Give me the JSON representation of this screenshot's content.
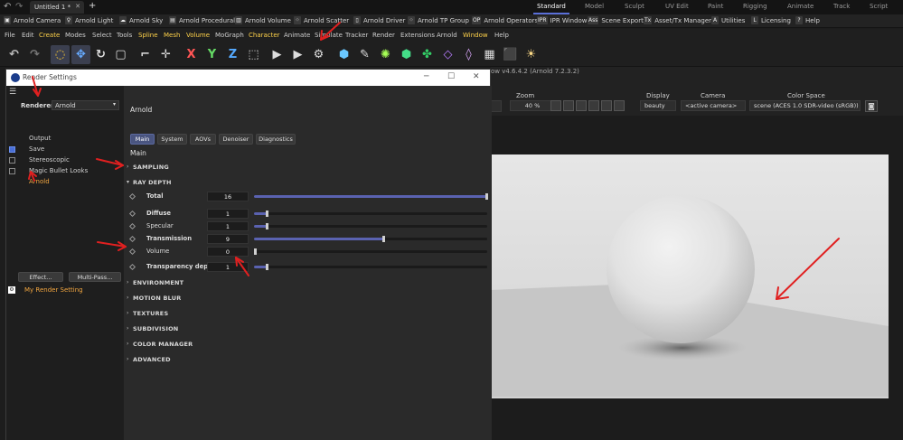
{
  "titlebar": {
    "doc_tab": "Untitled 1 *",
    "plus": "+",
    "layouts": [
      "Standard",
      "Model",
      "Sculpt",
      "UV Edit",
      "Paint",
      "Rigging",
      "Animate",
      "Track",
      "Script"
    ],
    "active_layout": "Standard"
  },
  "pluginbar": [
    {
      "icon": "camera-icon",
      "label": "Arnold Camera",
      "glyph": "▣"
    },
    {
      "icon": "light-icon",
      "label": "Arnold Light",
      "glyph": "♀"
    },
    {
      "icon": "cloud-icon",
      "label": "Arnold Sky",
      "glyph": "☁"
    },
    {
      "icon": "procedural-icon",
      "label": "Arnold Procedural",
      "glyph": "▤"
    },
    {
      "icon": "volume-icon",
      "label": "Arnold Volume",
      "glyph": "▥"
    },
    {
      "icon": "scatter-icon",
      "label": "Arnold Scatter",
      "glyph": "⁘"
    },
    {
      "icon": "driver-icon",
      "label": "Arnold Driver",
      "glyph": "▯"
    },
    {
      "icon": "tp-group-icon",
      "label": "Arnold TP Group",
      "glyph": "⁘"
    },
    {
      "icon": "operators-icon",
      "label": "Arnold Operators",
      "glyph": "OP"
    },
    {
      "icon": "ipr-icon",
      "label": "IPR Window",
      "glyph": "IPR"
    },
    {
      "icon": "ass-icon",
      "label": "Scene Export",
      "glyph": "Ass"
    },
    {
      "icon": "tx-icon",
      "label": "Asset/Tx Manager",
      "glyph": "Tx"
    },
    {
      "icon": "utilities-icon",
      "label": "Utilities",
      "glyph": "A"
    },
    {
      "icon": "licensing-icon",
      "label": "Licensing",
      "glyph": "L"
    },
    {
      "icon": "help-icon",
      "label": "Help",
      "glyph": "?"
    }
  ],
  "menubar": [
    "File",
    "Edit",
    "Create",
    "Modes",
    "Select",
    "Tools",
    "Spline",
    "Mesh",
    "Volume",
    "MoGraph",
    "Character",
    "Animate",
    "Simulate",
    "Tracker",
    "Render",
    "Extensions",
    "Arnold",
    "Window",
    "Help"
  ],
  "toolbar_icons": [
    "undo-icon",
    "redo-icon",
    "live-select-icon",
    "move-icon",
    "rotate-icon",
    "scale-icon",
    "snap-icon",
    "axis-icon",
    "x-axis-icon",
    "y-axis-icon",
    "z-axis-icon",
    "coordinate-icon",
    "render-region-icon",
    "render-view-icon",
    "render-settings-icon",
    "cube-icon",
    "pen-icon",
    "subdivision-icon",
    "extrude-icon",
    "cloner-icon",
    "deformer-icon",
    "field-icon",
    "environment-icon",
    "camera-icon",
    "light-icon"
  ],
  "toolbar_glyphs": [
    "↶",
    "↷",
    "◌",
    "✥",
    "↻",
    "▢",
    "⌐",
    "✛",
    "X",
    "Y",
    "Z",
    "⬚",
    "▶",
    "▶",
    "⚙",
    "⬢",
    "✎",
    "✺",
    "⬢",
    "✤",
    "◇",
    "◊",
    "▦",
    "⬛",
    "☀"
  ],
  "viewport_bar": {
    "ipr_title": "ow v4.6.4.2 (Arnold 7.2.3.2)",
    "zoom_label": "Zoom",
    "zoom_value": "40 %",
    "display_label": "Display",
    "display_value": "beauty",
    "camera_label": "Camera",
    "camera_value": "<active camera>",
    "colorspace_label": "Color Space",
    "colorspace_value": "scene (ACES 1.0 SDR-video (sRGB))"
  },
  "render_settings": {
    "title": "Render Settings",
    "renderer_label": "Renderer",
    "renderer_value": "Arnold",
    "side_items": [
      {
        "label": "Output",
        "checkbox": null,
        "active": false
      },
      {
        "label": "Save",
        "checkbox": true,
        "active": false
      },
      {
        "label": "Stereoscopic",
        "checkbox": false,
        "active": false
      },
      {
        "label": "Magic Bullet Looks",
        "checkbox": false,
        "active": false
      },
      {
        "label": "Arnold",
        "checkbox": null,
        "active": true
      }
    ],
    "effect_button": "Effect...",
    "multipass_button": "Multi-Pass...",
    "my_setting": "My Render Setting",
    "panel_title": "Arnold",
    "tabs": [
      "Main",
      "System",
      "AOVs",
      "Denoiser",
      "Diagnostics"
    ],
    "active_tab": "Main",
    "section_title": "Main",
    "sections": [
      "SAMPLING",
      "RAY DEPTH",
      "ENVIRONMENT",
      "MOTION BLUR",
      "TEXTURES",
      "SUBDIVISION",
      "COLOR MANAGER",
      "ADVANCED"
    ],
    "ray_depth": [
      {
        "name": "Total",
        "value": "16",
        "bold": true,
        "level": 1.0
      },
      {
        "name": "Diffuse",
        "value": "1",
        "bold": true,
        "level": 0.06
      },
      {
        "name": "Specular",
        "value": "1",
        "bold": false,
        "level": 0.06
      },
      {
        "name": "Transmission",
        "value": "9",
        "bold": true,
        "level": 0.56
      },
      {
        "name": "Volume",
        "value": "0",
        "bold": false,
        "level": 0.0
      },
      {
        "name": "Transparency depth",
        "value": "1",
        "bold": true,
        "level": 0.06
      }
    ]
  },
  "colors": {
    "accent": "#5a6fd8",
    "arrow": "#e02020",
    "active_side": "#f2a640",
    "menu_highlight": "#ffd24a"
  }
}
